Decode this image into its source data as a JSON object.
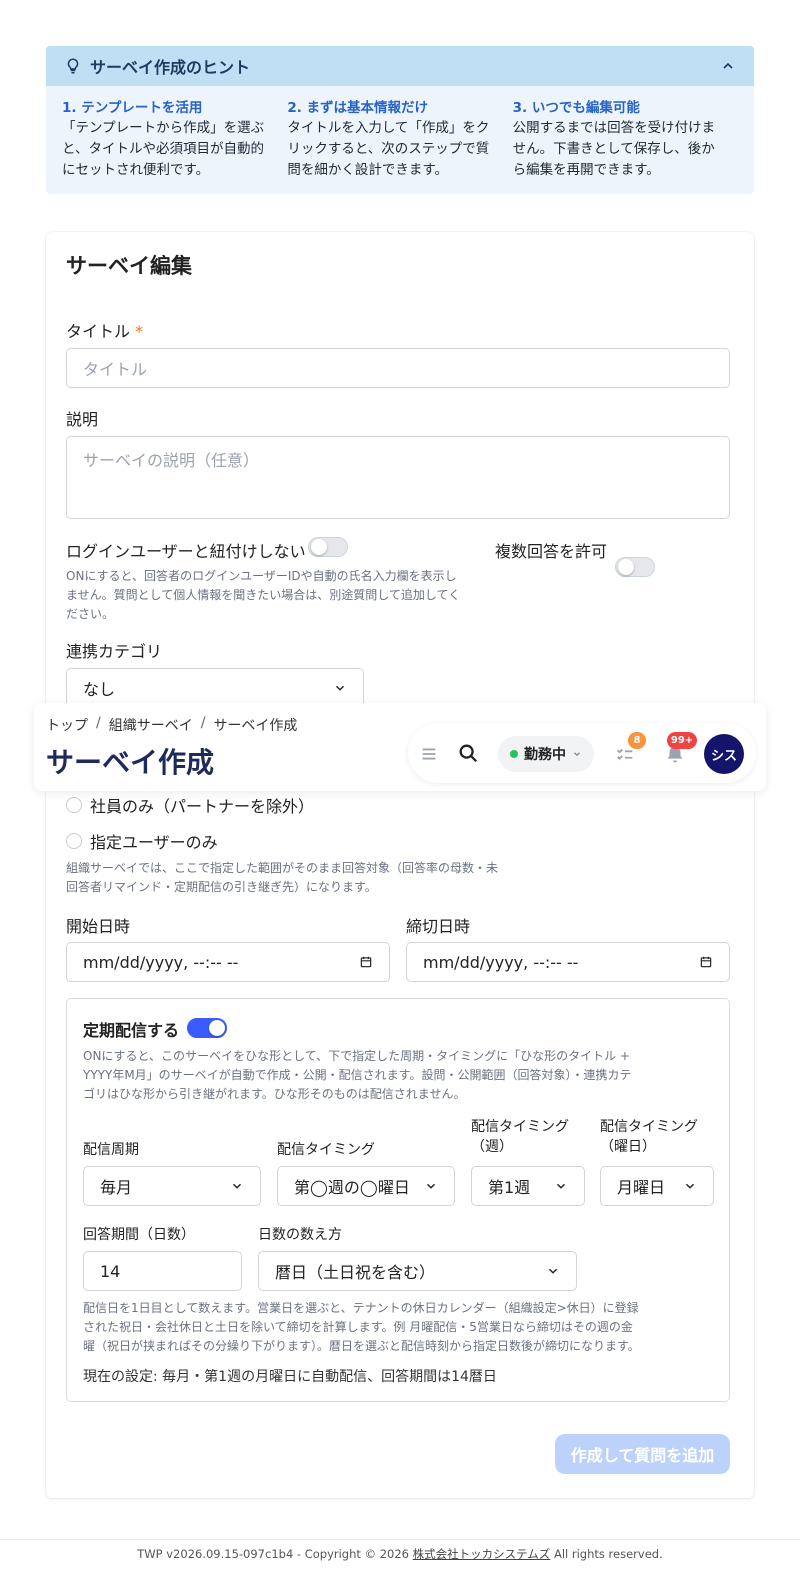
{
  "hint": {
    "title": "サーベイ作成のヒント",
    "items": [
      {
        "heading": "1. テンプレートを活用",
        "body": "「テンプレートから作成」を選ぶと、タイトルや必須項目が自動的にセットされ便利です。"
      },
      {
        "heading": "2. まずは基本情報だけ",
        "body": "タイトルを入力して「作成」をクリックすると、次のステップで質問を細かく設計できます。"
      },
      {
        "heading": "3. いつでも編集可能",
        "body": "公開するまでは回答を受け付けません。下書きとして保存し、後から編集を再開できます。"
      }
    ]
  },
  "form": {
    "heading": "サーベイ編集",
    "title_label": "タイトル",
    "title_required_mark": "*",
    "title_placeholder": "タイトル",
    "desc_label": "説明",
    "desc_placeholder": "サーベイの説明（任意）",
    "anon_label": "ログインユーザーと紐付けしない",
    "anon_on": false,
    "anon_help": "ONにすると、回答者のログインユーザーIDや自動の氏名入力欄を表示しません。質問として個人情報を聞きたい場合は、別途質問して追加してください。",
    "multi_label": "複数回答を許可",
    "multi_on": false,
    "category_label": "連携カテゴリ",
    "category_value": "なし",
    "scope_options": [
      "社員のみ（パートナーを除外）",
      "指定ユーザーのみ"
    ],
    "scope_help": "組織サーベイでは、ここで指定した範囲がそのまま回答対象（回答率の母数・未回答者リマインド・定期配信の引き継ぎ先）になります。",
    "start_label": "開始日時",
    "start_placeholder": "mm/dd/yyyy, --:-- --",
    "end_label": "締切日時",
    "end_placeholder": "mm/dd/yyyy, --:-- --",
    "recurring": {
      "label": "定期配信する",
      "on": true,
      "help": "ONにすると、このサーベイをひな形として、下で指定した周期・タイミングに「ひな形のタイトル + YYYY年M月」のサーベイが自動で作成・公開・配信されます。設問・公開範囲（回答対象）・連携カテゴリはひな形から引き継がれます。ひな形そのものは配信されません。",
      "cycle_label": "配信周期",
      "cycle_value": "毎月",
      "timing_label": "配信タイミング",
      "timing_value": "第◯週の◯曜日",
      "week_label": "配信タイミング（週）",
      "week_value": "第1週",
      "weekday_label": "配信タイミング（曜日）",
      "weekday_value": "月曜日",
      "period_label": "回答期間（日数）",
      "period_value": "14",
      "count_label": "日数の数え方",
      "count_value": "暦日（土日祝を含む）",
      "count_help": "配信日を1日目として数えます。営業日を選ぶと、テナントの休日カレンダー（組織設定>休日）に登録された祝日・会社休日と土日を除いて締切を計算します。例 月曜配信・5営業日なら締切はその週の金曜（祝日が挟まればその分繰り下がります）。暦日を選ぶと配信時刻から指定日数後が締切になります。",
      "summary": "現在の設定: 毎月・第1週の月曜日に自動配信、回答期間は14暦日"
    },
    "submit_label": "作成して質問を追加"
  },
  "header": {
    "breadcrumbs": [
      "トップ",
      "組織サーベイ",
      "サーベイ作成"
    ],
    "separator": "/",
    "page_title": "サーベイ作成",
    "status_label": "勤務中",
    "tasks_badge": "8",
    "notif_badge": "99+",
    "avatar_text": "シス"
  },
  "footer": {
    "prefix": "TWP v2026.09.15-097c1b4 - Copyright © 2026",
    "company": "株式会社トッカシステムズ",
    "suffix": "All rights reserved."
  },
  "colors": {
    "accent": "#3b5bfd",
    "hint_header": "#bfdff5",
    "hint_bg": "#eef4fb",
    "submit_disabled": "#bcd2fb",
    "avatar": "#14146b",
    "status_dot": "#22c55e",
    "tasks_badge": "#fb923c",
    "notif_badge": "#ef4444"
  }
}
